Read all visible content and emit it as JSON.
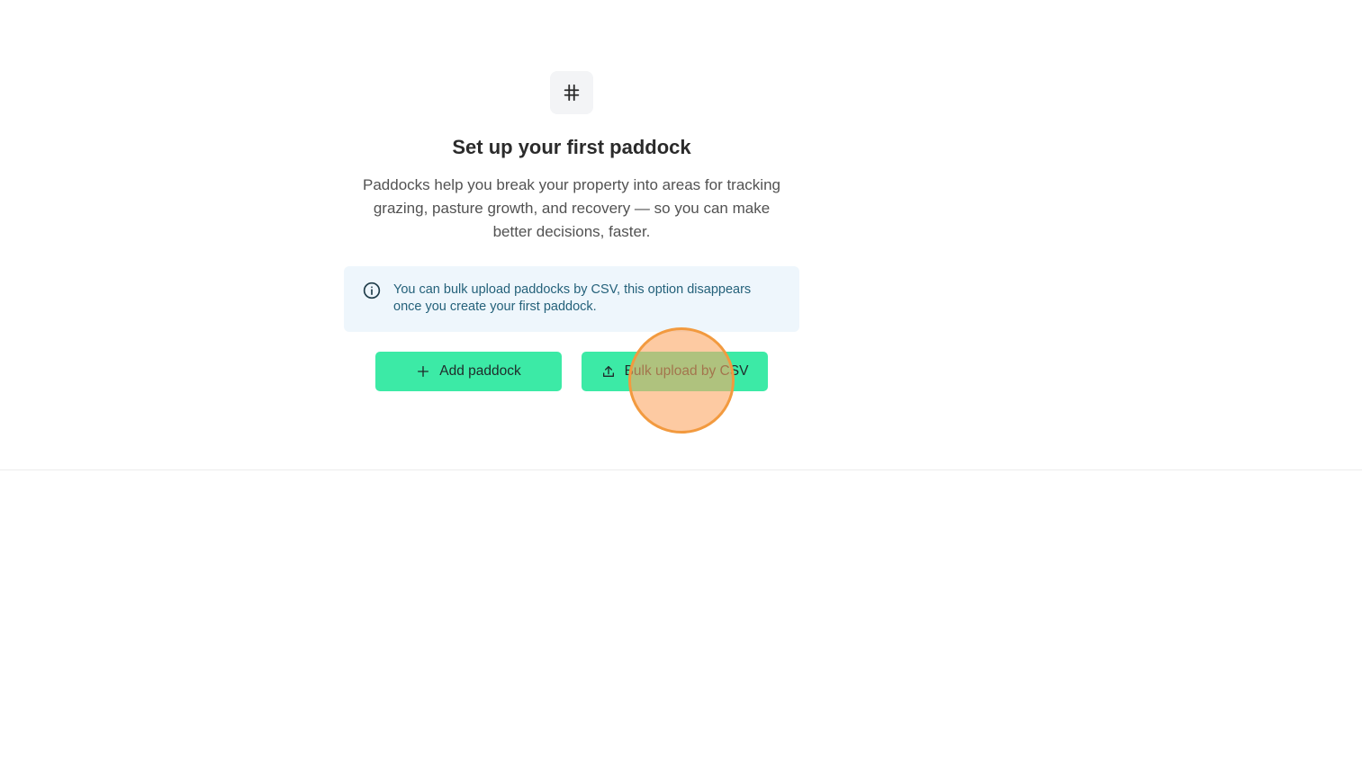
{
  "empty_state": {
    "icon": "hash-icon",
    "title": "Set up your first paddock",
    "description": "Paddocks help you break your property into areas for tracking grazing, pasture growth, and recovery — so you can make better decisions, faster.",
    "info": {
      "icon": "info-icon",
      "text": "You can bulk upload paddocks by CSV, this option disappears once you create your first paddock."
    },
    "actions": {
      "add_label": "Add paddock",
      "add_icon": "plus-icon",
      "bulk_label": "Bulk upload by CSV",
      "bulk_icon": "upload-icon"
    }
  },
  "colors": {
    "button_bg": "#3ceaa6",
    "info_bg": "#eef6fc",
    "info_text": "#24617a",
    "click_marker": "#f29a3f"
  }
}
